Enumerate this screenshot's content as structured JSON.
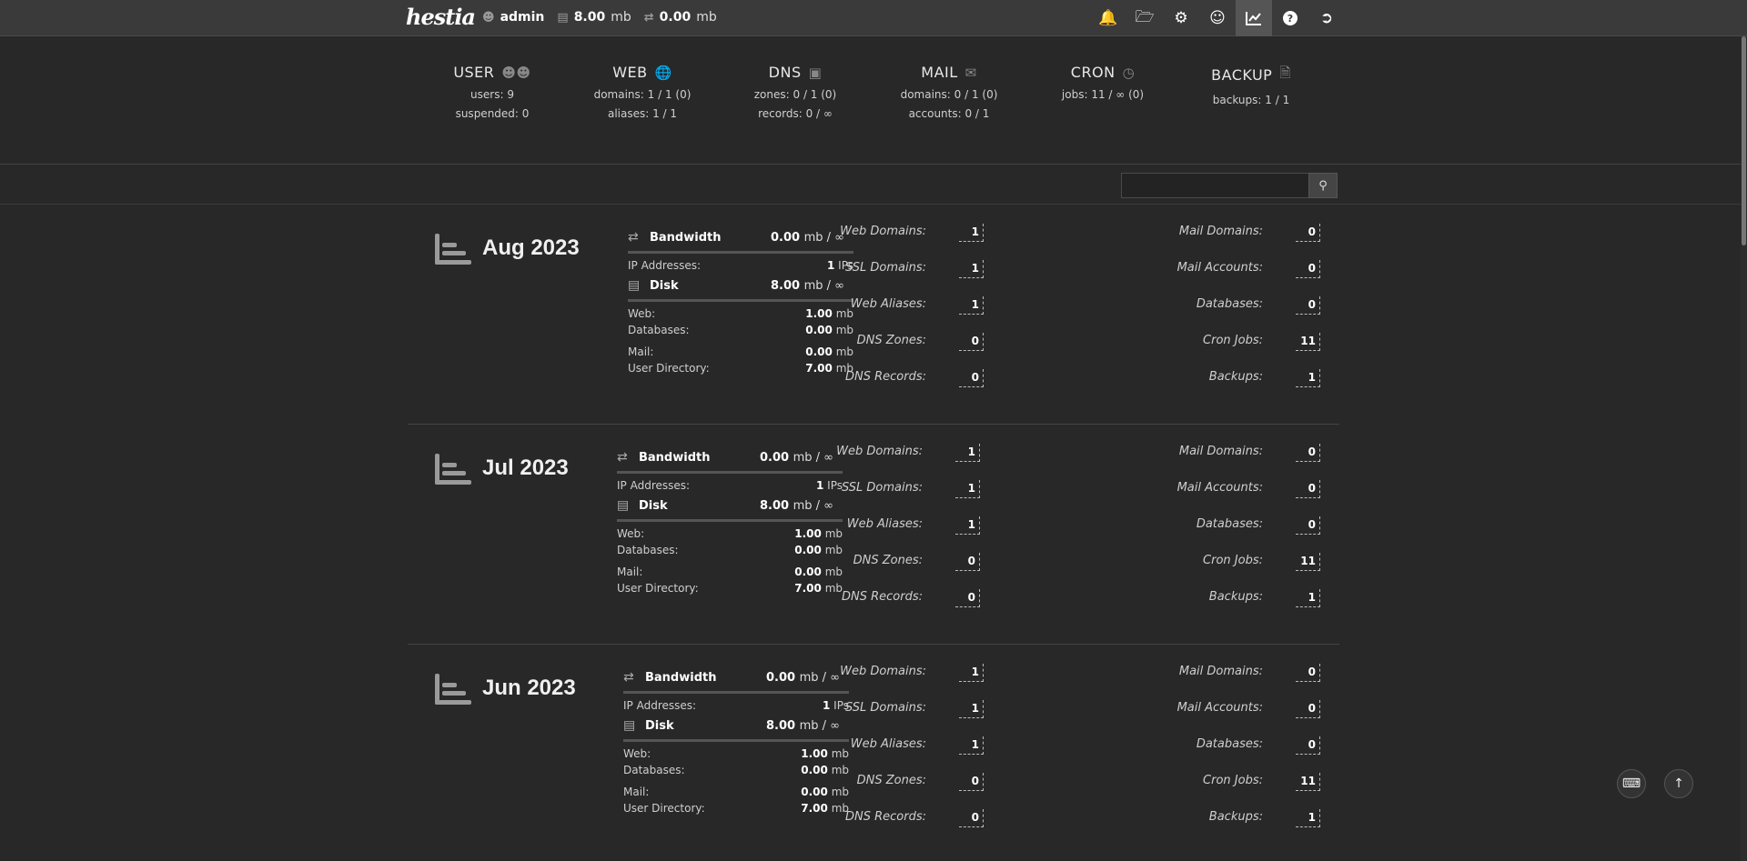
{
  "app": {
    "logo": "hestia"
  },
  "topbar": {
    "user": "admin",
    "disk_value": "8.00",
    "disk_unit": "mb",
    "bandwidth_value": "0.00",
    "bandwidth_unit": "mb",
    "icons": [
      "bell-icon",
      "folder-icon",
      "gear-icon",
      "user-circle-icon",
      "chart-line-icon",
      "help-icon",
      "logout-icon"
    ]
  },
  "summary": [
    {
      "title": "USER",
      "icon": "users-icon",
      "lines": [
        "users: 9",
        "suspended: 0"
      ]
    },
    {
      "title": "WEB",
      "icon": "globe-icon",
      "lines": [
        "domains: 1 / 1 (0)",
        "aliases: 1 / 1"
      ]
    },
    {
      "title": "DNS",
      "icon": "address-book-icon",
      "lines": [
        "zones: 0 / 1 (0)",
        "records: 0 / ∞"
      ]
    },
    {
      "title": "MAIL",
      "icon": "mail-bulk-icon",
      "lines": [
        "domains: 0 / 1 (0)",
        "accounts: 0 / 1"
      ]
    },
    {
      "title": "CRON",
      "icon": "clock-icon",
      "lines": [
        "jobs: 11 / ∞ (0)"
      ]
    },
    {
      "title": "BACKUP",
      "icon": "file-zip-icon",
      "lines": [
        "backups: 1 / 1"
      ]
    }
  ],
  "search": {
    "placeholder": ""
  },
  "labels": {
    "bandwidth": "Bandwidth",
    "ip_addresses": "IP Addresses:",
    "ips_unit": "IPs",
    "disk": "Disk",
    "web": "Web:",
    "databases": "Databases:",
    "mail": "Mail:",
    "user_directory": "User Directory:",
    "mb": "mb",
    "mb_inf": "mb / ∞",
    "web_domains": "Web Domains:",
    "ssl_domains": "SSL Domains:",
    "web_aliases": "Web Aliases:",
    "dns_zones": "DNS Zones:",
    "dns_records": "DNS Records:",
    "mail_domains": "Mail Domains:",
    "mail_accounts": "Mail Accounts:",
    "databases_stat": "Databases:",
    "cron_jobs": "Cron Jobs:",
    "backups": "Backups:"
  },
  "months": [
    {
      "title": "Aug 2023",
      "bandwidth": "0.00",
      "ips": "1",
      "disk": "8.00",
      "web": "1.00",
      "databases": "0.00",
      "mail": "0.00",
      "user_directory": "7.00",
      "web_domains": "1",
      "ssl_domains": "1",
      "web_aliases": "1",
      "dns_zones": "0",
      "dns_records": "0",
      "mail_domains": "0",
      "mail_accounts": "0",
      "databases_count": "0",
      "cron_jobs": "11",
      "backups": "1"
    },
    {
      "title": "Jul 2023",
      "bandwidth": "0.00",
      "ips": "1",
      "disk": "8.00",
      "web": "1.00",
      "databases": "0.00",
      "mail": "0.00",
      "user_directory": "7.00",
      "web_domains": "1",
      "ssl_domains": "1",
      "web_aliases": "1",
      "dns_zones": "0",
      "dns_records": "0",
      "mail_domains": "0",
      "mail_accounts": "0",
      "databases_count": "0",
      "cron_jobs": "11",
      "backups": "1"
    },
    {
      "title": "Jun 2023",
      "bandwidth": "0.00",
      "ips": "1",
      "disk": "8.00",
      "web": "1.00",
      "databases": "0.00",
      "mail": "0.00",
      "user_directory": "7.00",
      "web_domains": "1",
      "ssl_domains": "1",
      "web_aliases": "1",
      "dns_zones": "0",
      "dns_records": "0",
      "mail_domains": "0",
      "mail_accounts": "0",
      "databases_count": "0",
      "cron_jobs": "11",
      "backups": "1"
    }
  ]
}
